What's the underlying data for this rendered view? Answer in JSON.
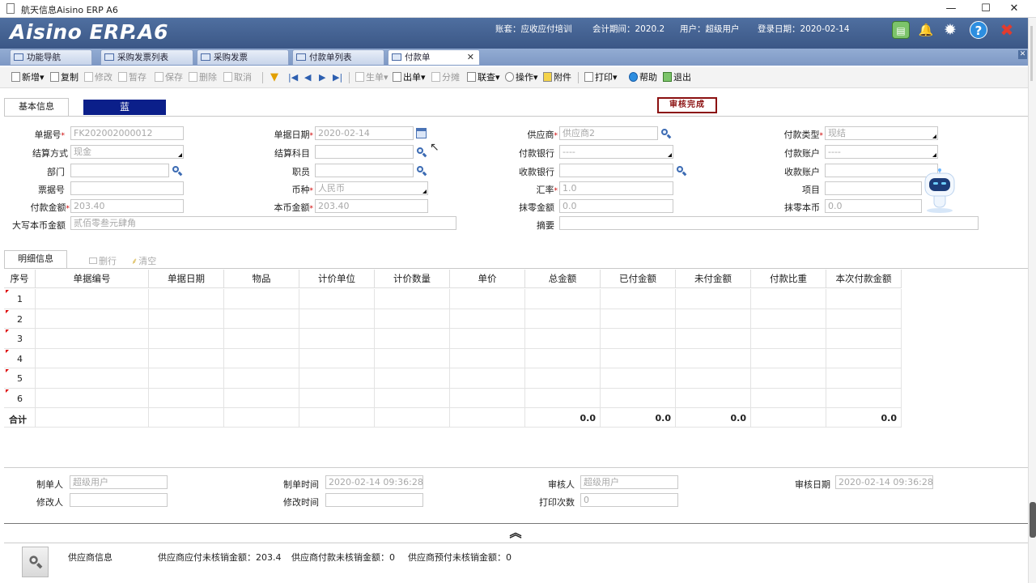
{
  "window": {
    "title": "航天信息Aisino ERP A6",
    "minimize": "—",
    "maximize": "☐",
    "close": "✕"
  },
  "header": {
    "logo": "Aisino ERP.A6",
    "account": "账套：应收应付培训",
    "period": "会计期间：2020.2",
    "user": "用户：超级用户",
    "login_date": "登录日期：2020-02-14"
  },
  "tabs": [
    {
      "label": "功能导航"
    },
    {
      "label": "采购发票列表"
    },
    {
      "label": "采购发票"
    },
    {
      "label": "付款单列表"
    },
    {
      "label": "付款单",
      "closable_glyph": "✕"
    }
  ],
  "toolbar": {
    "new": "新增",
    "copy": "复制",
    "edit": "修改",
    "temp_save": "暂存",
    "save": "保存",
    "delete": "删除",
    "cancel": "取消",
    "generate": "生单",
    "out": "出单",
    "split": "分摊",
    "link": "联查",
    "operate": "操作",
    "attach": "附件",
    "print": "打印",
    "help": "帮助",
    "exit": "退出"
  },
  "form": {
    "tab_basic": "基本信息",
    "color_tag": "蓝",
    "stamp": "审核完成",
    "doc_no_label": "单据号",
    "doc_no": "FK202002000012",
    "doc_date_label": "单据日期",
    "doc_date": "2020-02-14",
    "supplier_label": "供应商",
    "supplier": "供应商2",
    "pay_type_label": "付款类型",
    "pay_type": "现结",
    "settle_label": "结算方式",
    "settle": "现金",
    "settle_subject_label": "结算科目",
    "settle_subject": "",
    "pay_bank_label": "付款银行",
    "pay_bank": "----",
    "pay_account_label": "付款账户",
    "pay_account": "----",
    "dept_label": "部门",
    "dept": "",
    "staff_label": "职员",
    "staff": "",
    "recv_bank_label": "收款银行",
    "recv_bank": "",
    "recv_account_label": "收款账户",
    "recv_account": "",
    "bill_no_label": "票据号",
    "bill_no": "",
    "currency_label": "币种",
    "currency": "人民币",
    "rate_label": "汇率",
    "rate": "1.0",
    "project_label": "项目",
    "project": "",
    "pay_amount_label": "付款金额",
    "pay_amount": "203.40",
    "local_amount_label": "本币金额",
    "local_amount": "203.40",
    "round_amount_label": "抹零金额",
    "round_amount": "0.0",
    "round_local_label": "抹零本币",
    "round_local": "0.0",
    "uppercase_label": "大写本币金额",
    "uppercase": "贰佰零叁元肆角",
    "summary_label": "摘要",
    "summary": ""
  },
  "detail": {
    "tab": "明细信息",
    "delete_row": "删行",
    "clear": "清空",
    "columns": [
      "序号",
      "单据编号",
      "单据日期",
      "物品",
      "计价单位",
      "计价数量",
      "单价",
      "总金额",
      "已付金额",
      "未付金额",
      "付款比重",
      "本次付款金额"
    ],
    "rows": [
      "1",
      "2",
      "3",
      "4",
      "5",
      "6"
    ],
    "total_label": "合计",
    "totals": {
      "total": "0.0",
      "paid": "0.0",
      "unpaid": "0.0",
      "current": "0.0"
    }
  },
  "audit": {
    "maker_label": "制单人",
    "maker": "超级用户",
    "make_time_label": "制单时间",
    "make_time": "2020-02-14 09:36:28",
    "auditor_label": "审核人",
    "auditor": "超级用户",
    "audit_date_label": "审核日期",
    "audit_date": "2020-02-14 09:36:28",
    "modifier_label": "修改人",
    "modifier": "",
    "modify_time_label": "修改时间",
    "modify_time": "",
    "print_count_label": "打印次数",
    "print_count": "0"
  },
  "supplier_bar": {
    "label": "供应商信息",
    "stat1": "供应商应付未核销金额：203.4",
    "stat2": "供应商付款未核销金额：0",
    "stat3": "供应商预付未核销金额：0",
    "collapse": "︽"
  }
}
